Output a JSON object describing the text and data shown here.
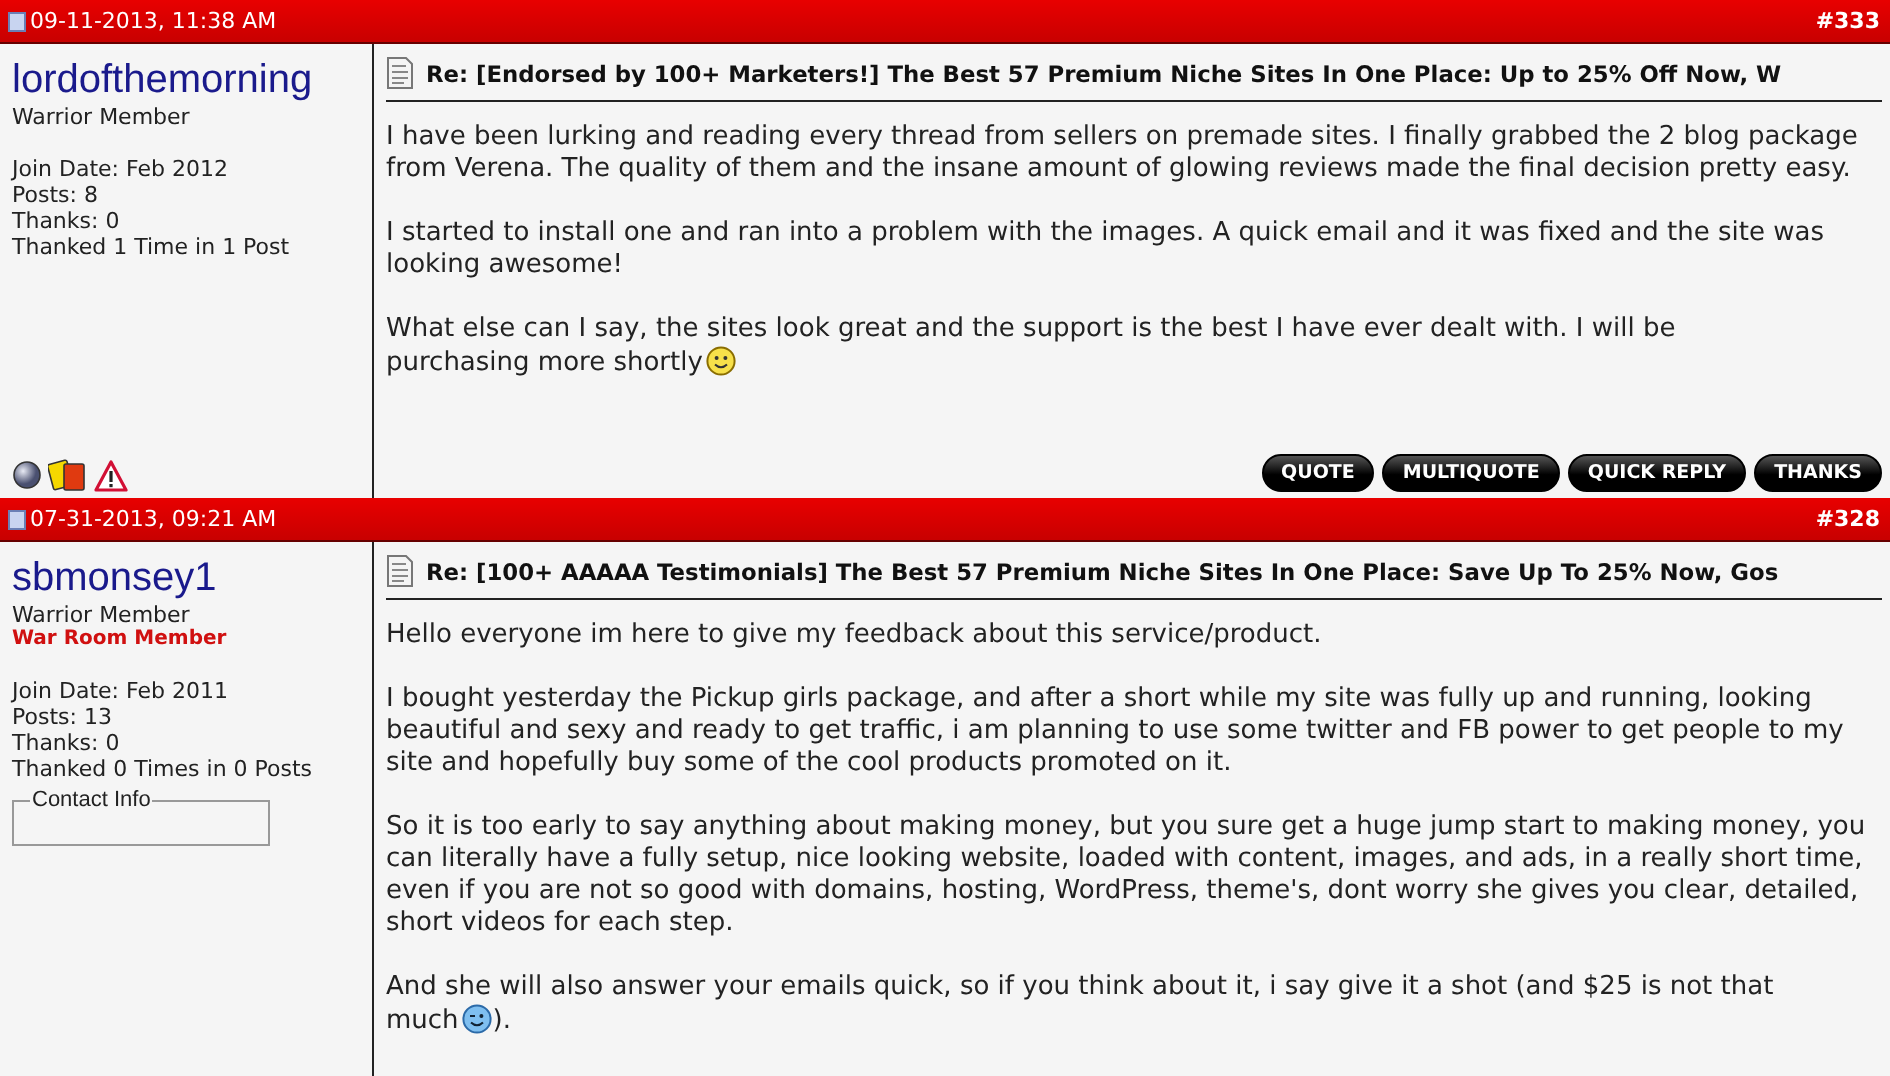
{
  "posts": [
    {
      "date": "09-11-2013, 11:38 AM",
      "number": "#333",
      "user": {
        "name": "lordofthemorning",
        "title": "Warrior Member",
        "stats": [
          "Join Date: Feb 2012",
          "Posts: 8",
          "Thanks: 0",
          "Thanked 1 Time in 1 Post"
        ],
        "status_icons": [
          {
            "kind": "sphere"
          },
          {
            "kind": "cards"
          },
          {
            "kind": "warning"
          }
        ]
      },
      "post_title": "Re: [Endorsed by 100+ Marketers!] The Best 57 Premium Niche Sites In One Place: Up to 25% Off Now, W",
      "paragraphs": [
        [
          {
            "kind": "text",
            "text": "I have been lurking and reading every thread from sellers on premade sites. I finally grabbed the 2 blog package from Verena. The quality of them and the insane amount of glowing reviews made the final decision pretty easy."
          }
        ],
        [
          {
            "kind": "text",
            "text": "I started to install one and ran into a problem with the images. A quick email and it was fixed and the site was looking awesome!"
          }
        ],
        [
          {
            "kind": "line",
            "text": "What else can I say, the sites look great and the support is the best I have ever dealt with. I will be"
          },
          {
            "kind": "text",
            "text": "purchasing more shortly"
          },
          {
            "kind": "smile"
          }
        ]
      ],
      "buttons": [
        "QUOTE",
        "MULTIQUOTE",
        "QUICK REPLY",
        "THANKS"
      ]
    },
    {
      "date": "07-31-2013, 09:21 AM",
      "number": "#328",
      "user": {
        "name": "sbmonsey1",
        "title": "Warrior Member",
        "extra_title": "War Room Member",
        "stats": [
          "Join Date: Feb 2011",
          "Posts: 13",
          "Thanks: 0",
          "Thanked 0 Times in 0 Posts"
        ],
        "contact_box": "Contact Info"
      },
      "post_title": "Re: [100+ AAAAA Testimonials] The Best 57 Premium Niche Sites In One Place: Save Up To 25% Now, Gos",
      "paragraphs": [
        [
          {
            "kind": "text",
            "text": "Hello everyone im here to give my feedback about this service/product."
          }
        ],
        [
          {
            "kind": "text",
            "text": "I bought yesterday the Pickup girls package, and after a short while my site was fully up and running, looking beautiful and sexy and ready to get traffic, i am planning to use some twitter and FB power to get people to my site and hopefully buy some of the cool products promoted on it."
          }
        ],
        [
          {
            "kind": "text",
            "text": "So it is too early to say anything about making money, but you sure get a huge jump start to making money, you can literally have a fully setup, nice looking website, loaded with content, images, and ads, in a really short time, even if you are not so good with domains, hosting, WordPress, theme's, dont worry she gives you clear, detailed, short videos for each step."
          }
        ],
        [
          {
            "kind": "line",
            "text": "And she will also answer your emails quick, so if you think about it, i say give it a shot (and $25 is not that"
          },
          {
            "kind": "text",
            "text": "much"
          },
          {
            "kind": "wink"
          },
          {
            "kind": "text",
            "text": ")."
          }
        ]
      ]
    }
  ]
}
